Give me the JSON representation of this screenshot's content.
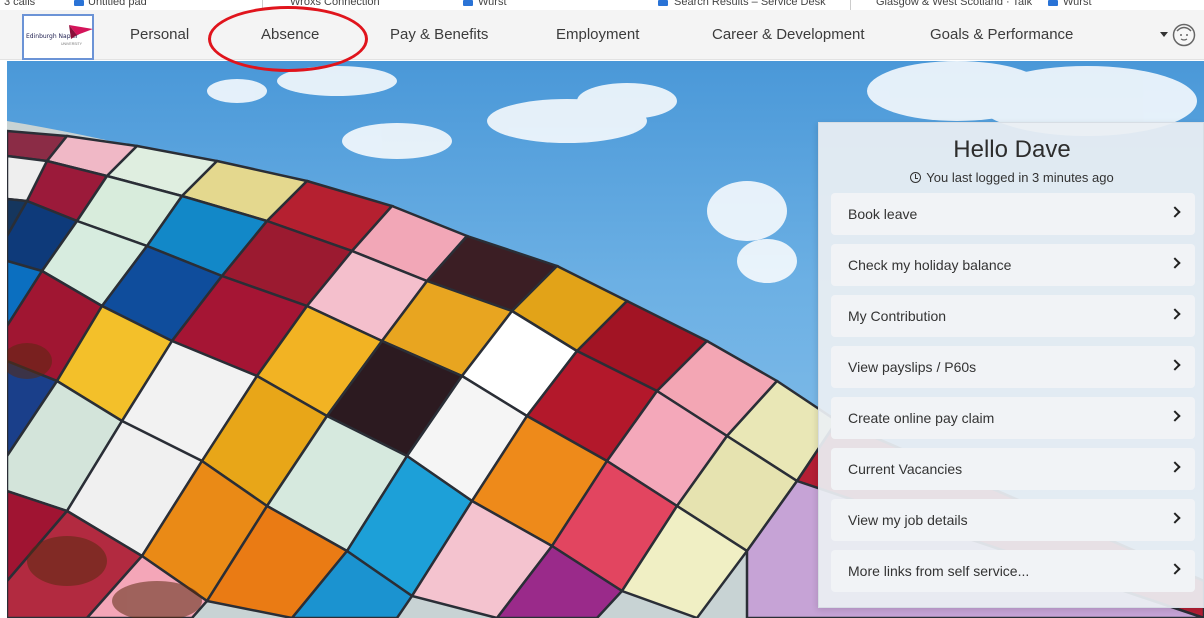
{
  "browser": {
    "bookmarks": [
      "3 calls",
      "Untitled pad",
      "Wroxs Connection",
      "Wurst",
      "Search Results – Service Desk",
      "Glasgow & West Scotland · Talk",
      "Wurst"
    ]
  },
  "header": {
    "logo_text": "Edinburgh Napier",
    "logo_subtext": "UNIVERSITY",
    "nav": [
      {
        "label": "Personal"
      },
      {
        "label": "Absence"
      },
      {
        "label": "Pay & Benefits"
      },
      {
        "label": "Employment"
      },
      {
        "label": "Career & Development"
      },
      {
        "label": "Goals & Performance"
      }
    ],
    "user_menu_icon": "avatar-icon",
    "dropdown_icon": "caret-down-icon"
  },
  "panel": {
    "greeting": "Hello Dave",
    "last_login": "You last logged in 3 minutes ago",
    "links": [
      {
        "label": "Book leave"
      },
      {
        "label": "Check my holiday balance"
      },
      {
        "label": "My Contribution"
      },
      {
        "label": "View payslips / P60s"
      },
      {
        "label": "Create online pay claim"
      },
      {
        "label": "Current Vacancies"
      },
      {
        "label": "View my job details"
      },
      {
        "label": "More links from self service..."
      }
    ]
  },
  "colors": {
    "annotation": "#e0141c",
    "nav_background": "#f4f4f4",
    "panel_background": "#ebeff3"
  }
}
